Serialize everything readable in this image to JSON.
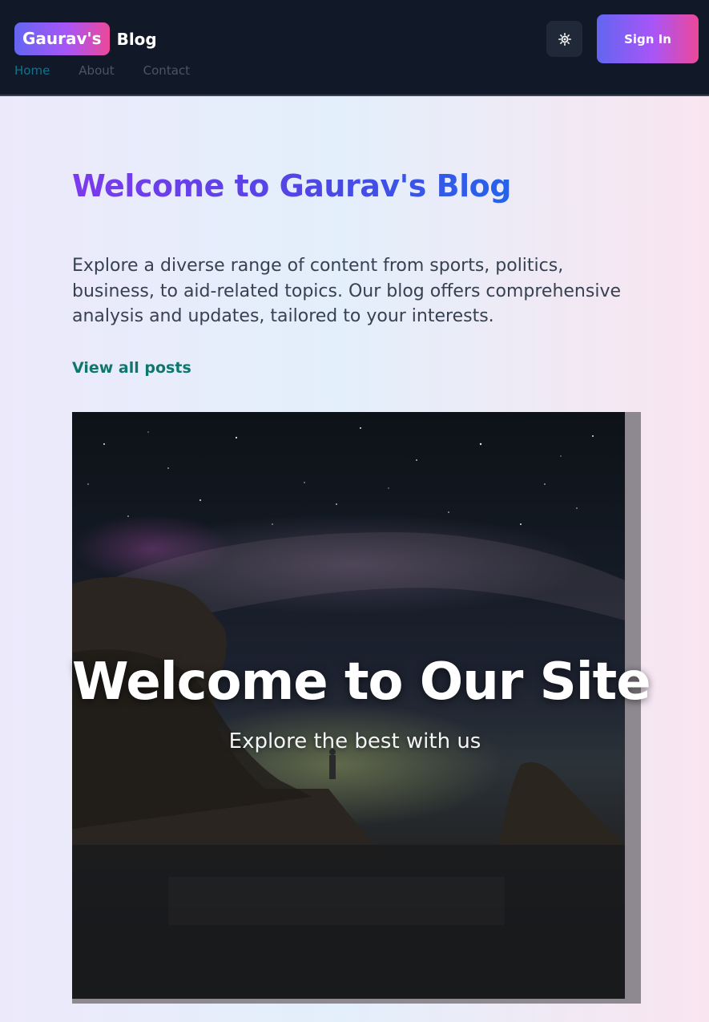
{
  "header": {
    "brand_pill": "Gaurav's",
    "brand_rest": "Blog",
    "nav": [
      {
        "label": "Home",
        "active": true
      },
      {
        "label": "About",
        "active": false
      },
      {
        "label": "Contact",
        "active": false
      }
    ],
    "theme_toggle_icon": "sun-icon",
    "sign_in_label": "Sign In"
  },
  "main": {
    "title": "Welcome to Gaurav's Blog",
    "intro": "Explore a diverse range of content from sports, politics, business, to aid-related topics. Our blog offers comprehensive analysis and updates, tailored to your interests.",
    "view_all_label": "View all posts"
  },
  "hero": {
    "title": "Welcome to Our Site",
    "subtitle": "Explore the best with us"
  },
  "colors": {
    "header_bg": "#111827",
    "accent_gradient_start": "#6366f1",
    "accent_gradient_end": "#ec4899",
    "link_teal": "#0f766e",
    "nav_active": "#0e7490"
  }
}
